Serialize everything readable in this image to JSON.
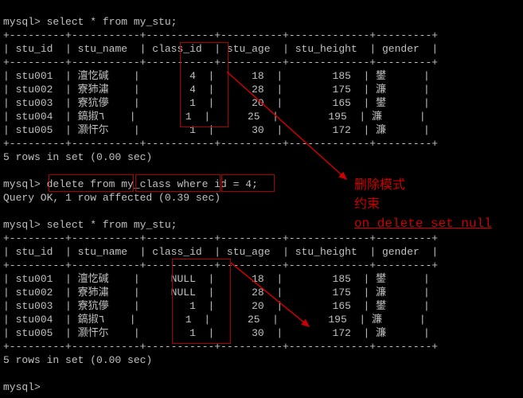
{
  "prompt": "mysql>",
  "queries": {
    "q1": "select * from my_stu;",
    "q2": "delete from my_class where id = 4;",
    "q3": "select * from my_stu;"
  },
  "results": {
    "r1": "5 rows in set (0.00 sec)",
    "r2": "Query OK, 1 row affected (0.39 sec)",
    "r3": "5 rows in set (0.00 sec)"
  },
  "columns": {
    "c1": "stu_id",
    "c2": "stu_name",
    "c3": "class_id",
    "c4": "stu_age",
    "c5": "stu_height",
    "c6": "gender"
  },
  "table1": {
    "r1": {
      "id": "stu001",
      "name": "澶忔碱",
      "class": "4",
      "age": "18",
      "h": "185",
      "g": "鐢"
    },
    "r2": {
      "id": "stu002",
      "name": "寮犻潚",
      "class": "4",
      "age": "28",
      "h": "175",
      "g": "濂"
    },
    "r3": {
      "id": "stu003",
      "name": "寮犺儚",
      "class": "1",
      "age": "20",
      "h": "165",
      "g": "鐢"
    },
    "r4": {
      "id": "stu004",
      "name": "鎬掓٦",
      "class": "1",
      "age": "25",
      "h": "195",
      "g": "濂"
    },
    "r5": {
      "id": "stu005",
      "name": "灏忓尓",
      "class": "1",
      "age": "30",
      "h": "172",
      "g": "濂"
    }
  },
  "table2": {
    "r1": {
      "id": "stu001",
      "name": "澶忔碱",
      "class": "NULL",
      "age": "18",
      "h": "185",
      "g": "鐢"
    },
    "r2": {
      "id": "stu002",
      "name": "寮犻潚",
      "class": "NULL",
      "age": "28",
      "h": "175",
      "g": "濂"
    },
    "r3": {
      "id": "stu003",
      "name": "寮犺儚",
      "class": "1",
      "age": "20",
      "h": "165",
      "g": "鐢"
    },
    "r4": {
      "id": "stu004",
      "name": "鎬掓٦",
      "class": "1",
      "age": "25",
      "h": "195",
      "g": "濂"
    },
    "r5": {
      "id": "stu005",
      "name": "灏忓尓",
      "class": "1",
      "age": "30",
      "h": "172",
      "g": "濂"
    }
  },
  "sep": {
    "full": "+---------+-----------+-----------+----------+-------------+---------+"
  },
  "annotations": {
    "a1": "删除模式",
    "a2": "约束",
    "a3": "on_delete_set_null"
  },
  "chart_data": {
    "type": "table",
    "title": "my_stu before and after delete from my_class where id=4 (on_delete_set_null)",
    "columns": [
      "stu_id",
      "stu_name",
      "class_id",
      "stu_age",
      "stu_height",
      "gender"
    ],
    "before": [
      [
        "stu001",
        "澶忔碱",
        4,
        18,
        185,
        "鐢"
      ],
      [
        "stu002",
        "寮犻潚",
        4,
        28,
        175,
        "濂"
      ],
      [
        "stu003",
        "寮犺儚",
        1,
        20,
        165,
        "鐢"
      ],
      [
        "stu004",
        "鎬掓٦",
        1,
        25,
        195,
        "濂"
      ],
      [
        "stu005",
        "灏忓尓",
        1,
        30,
        172,
        "濂"
      ]
    ],
    "after": [
      [
        "stu001",
        "澶忔碱",
        null,
        18,
        185,
        "鐢"
      ],
      [
        "stu002",
        "寮犻潚",
        null,
        28,
        175,
        "濂"
      ],
      [
        "stu003",
        "寮犺儚",
        1,
        20,
        165,
        "鐢"
      ],
      [
        "stu004",
        "鎬掓٦",
        1,
        25,
        195,
        "濂"
      ],
      [
        "stu005",
        "灏忓尓",
        1,
        30,
        172,
        "濂"
      ]
    ]
  }
}
